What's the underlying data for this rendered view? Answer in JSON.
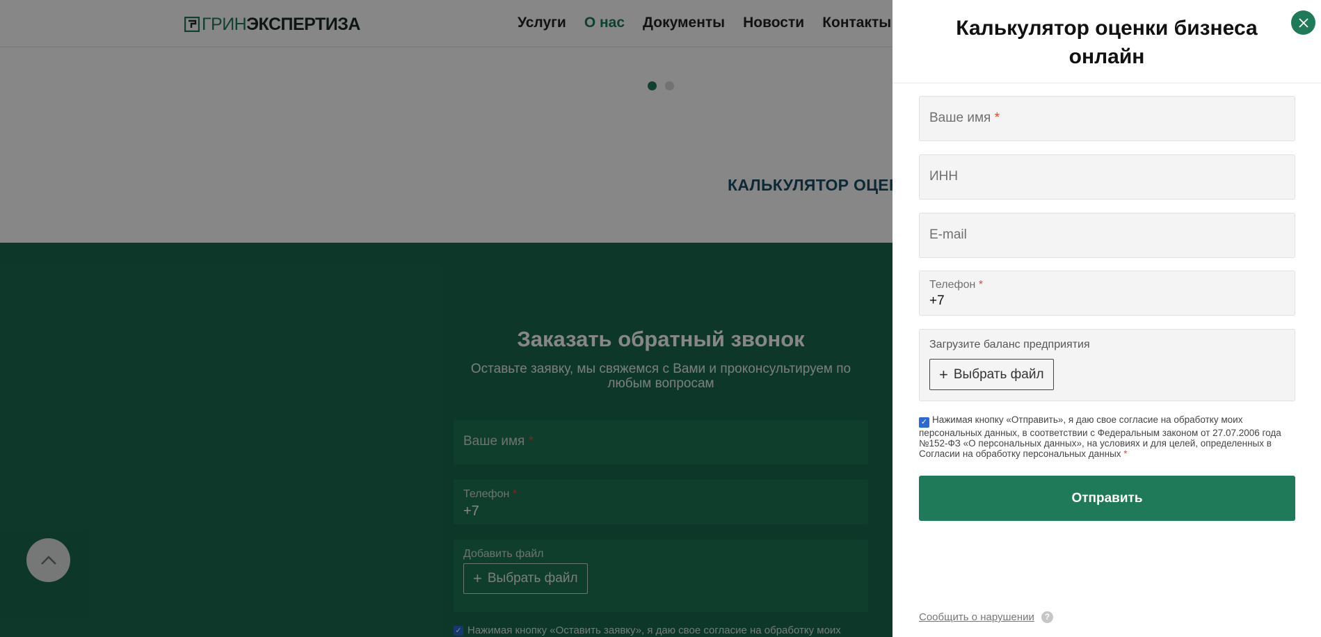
{
  "header": {
    "logo": {
      "part_a": "ГРИН",
      "part_b": "ЭКСПЕРТИЗА"
    },
    "nav": [
      {
        "label": "Услуги",
        "active": false
      },
      {
        "label": "О нас",
        "active": true
      },
      {
        "label": "Документы",
        "active": false
      },
      {
        "label": "Новости",
        "active": false
      },
      {
        "label": "Контакты",
        "active": false
      }
    ]
  },
  "hero": {
    "slider": {
      "total": 2,
      "active": 1
    },
    "calc_heading": "КАЛЬКУЛЯТОР ОЦЕН"
  },
  "callback": {
    "title": "Заказать обратный звонок",
    "subtitle": "Оставьте заявку, мы свяжемся с Вами и проконсультируем по любым вопросам",
    "name_placeholder": "Ваше имя",
    "phone_label": "Телефон",
    "phone_value": "+7",
    "file_label": "Добавить файл",
    "file_button": "Выбрать файл",
    "consent_text": "Нажимая кнопку «Оставить заявку», я даю свое согласие на обработку моих"
  },
  "panel": {
    "title": "Калькулятор оценки бизнеса онлайн",
    "fields": {
      "name_placeholder": "Ваше имя",
      "inn_placeholder": "ИНН",
      "email_placeholder": "E-mail",
      "phone_label": "Телефон",
      "phone_value": "+7"
    },
    "upload_label": "Загрузите баланс предприятия",
    "upload_button": "Выбрать файл",
    "consent_checked": true,
    "consent_text": "Нажимая кнопку «Отправить», я даю свое согласие на обработку моих персональных данных, в соответствии с Федеральным законом от 27.07.2006 года №152-ФЗ «О персональных данных», на условиях и для целей, определенных в Согласии на обработку персональных данных",
    "submit_label": "Отправить",
    "report_link": "Сообщить о нарушении",
    "required_mark": "*"
  },
  "colors": {
    "brand_green": "#1f7a5a",
    "section_green": "#1a6b4f",
    "required": "#e24b3b",
    "heading_blue": "#1a4e63"
  },
  "icons": {
    "close": "close-icon",
    "plus": "plus-icon",
    "help": "help-icon",
    "scroll_top": "chevron-up-icon",
    "checkbox": "checkbox-checked-icon"
  }
}
